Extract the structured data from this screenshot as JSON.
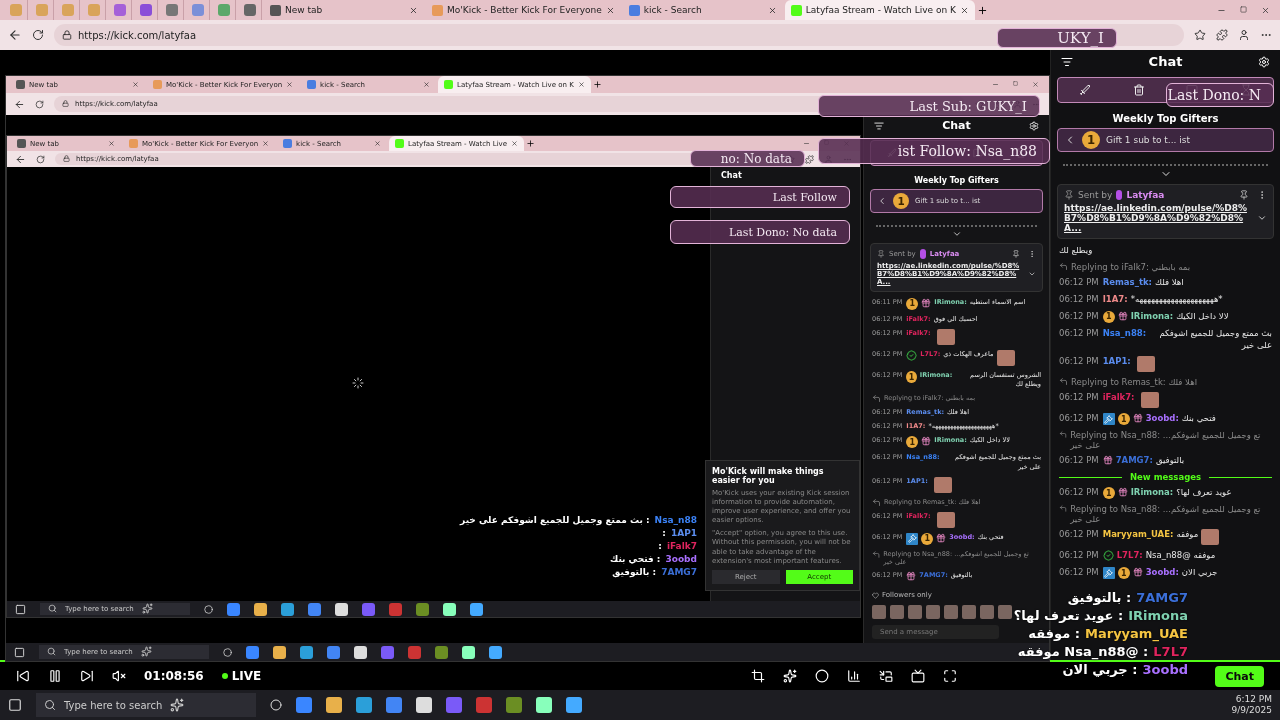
{
  "tabs": [
    {
      "label": "New tab",
      "selected": false
    },
    {
      "label": "Mo'Kick - Better Kick For Everyone",
      "selected": false
    },
    {
      "label": "kick - Search",
      "selected": false
    },
    {
      "label": "Latyfaa Stream - Watch Live on K",
      "selected": true
    }
  ],
  "address": {
    "url": "https://kick.com/latyfaa"
  },
  "chat": {
    "title": "Chat",
    "gifters_title": "Weekly Top Gifters",
    "gifter": {
      "rank": "1",
      "text": "Gift 1 sub to t... ist"
    },
    "pinned": {
      "sent_by": "Sent by",
      "user": "Latyfaa",
      "link": "https://ae.linkedin.com/pulse/%D8%B7%D8%B1%D9%8A%D9%82%D8%A..."
    },
    "messages": [
      {
        "kind": "text",
        "text": "ويطلع لك"
      },
      {
        "kind": "reply",
        "text": "Replying to iFalk7: بمه بابطني"
      },
      {
        "kind": "message",
        "time": "06:12 PM",
        "user": "Remas_tk:",
        "color": "#5b8def",
        "text": "اهلا فلك"
      },
      {
        "kind": "message",
        "time": "06:12 PM",
        "user": "I1A7:",
        "color": "#f08a8a",
        "text": "*ههههههههههههههههههههه*"
      },
      {
        "kind": "message",
        "time": "06:12 PM",
        "badges": [
          {
            "kind": "sub",
            "text": "1"
          },
          {
            "kind": "gift"
          }
        ],
        "user": "IRimona:",
        "color": "#7fd1b0",
        "text": "لالا داخل الكيك"
      },
      {
        "kind": "message",
        "time": "06:12 PM",
        "user": "Nsa_n88:",
        "color": "#3b82f6",
        "text": "بث ممتع وجميل للجميع اشوفكم على خير"
      },
      {
        "kind": "message",
        "time": "06:12 PM",
        "user": "1AP1:",
        "color": "#5b8def",
        "emote": true
      },
      {
        "kind": "reply",
        "text": "Replying to Remas_tk: اهلا فلك"
      },
      {
        "kind": "message",
        "time": "06:12 PM",
        "user": "iFalk7:",
        "color": "#e0245e",
        "emote": true
      },
      {
        "kind": "message",
        "time": "06:12 PM",
        "badges": [
          {
            "kind": "mod"
          },
          {
            "kind": "sub",
            "text": "1"
          },
          {
            "kind": "gift"
          }
        ],
        "user": "3oobd:",
        "color": "#a970ff",
        "text": "فتحي بنك"
      },
      {
        "kind": "reply",
        "text": "Replying to Nsa_n88: ...تع وجميل للجميع اشوفكم على خير"
      },
      {
        "kind": "message",
        "time": "06:12 PM",
        "badges": [
          {
            "kind": "gift"
          }
        ],
        "user": "7AMG7:",
        "color": "#3b6fd8",
        "text": "بالتوفيق"
      },
      {
        "kind": "divider",
        "text": "New messages"
      },
      {
        "kind": "message",
        "time": "06:12 PM",
        "badges": [
          {
            "kind": "sub",
            "text": "1"
          },
          {
            "kind": "gift"
          }
        ],
        "user": "IRimona:",
        "color": "#7fd1b0",
        "text": "عويد تعرف لها؟"
      },
      {
        "kind": "reply",
        "text": "Replying to Nsa_n88: ...تع وجميل للجميع اشوفكم على خير"
      },
      {
        "kind": "message",
        "time": "06:12 PM",
        "user": "Maryyam_UAE:",
        "color": "#f5c542",
        "text": "موفقه",
        "emote": true
      },
      {
        "kind": "message",
        "time": "06:12 PM",
        "badges": [
          {
            "kind": "verified"
          }
        ],
        "user": "L7L7:",
        "color": "#e0245e",
        "text": "موفقه @Nsa_n88"
      },
      {
        "kind": "message",
        "time": "06:12 PM",
        "badges": [
          {
            "kind": "mod"
          },
          {
            "kind": "sub",
            "text": "1"
          },
          {
            "kind": "gift"
          }
        ],
        "user": "3oobd:",
        "color": "#a970ff",
        "text": "جربي الان"
      }
    ]
  },
  "player": {
    "time": "01:08:56",
    "live": "LIVE",
    "chat_button": "Chat"
  },
  "banners": [
    "UKY_I",
    "Last Sub: GUKY_I",
    "no: No data",
    "ist Follow: Nsa_n88",
    "Last Dono: N",
    "Last Follow",
    "Last Dono: No data"
  ],
  "stream_overlay": [
    {
      "user": "7AMG7",
      "color": "#3b6fd8",
      "text": ": بالتوفيق"
    },
    {
      "user": "IRimona",
      "color": "#7fd1b0",
      "text": ": عويد تعرف لها؟"
    },
    {
      "user": "Maryyam_UAE",
      "color": "#f5c542",
      "text": ": موفقه"
    },
    {
      "user": "L7L7",
      "color": "#e0245e",
      "text": ": @Nsa_n88 موفقه"
    },
    {
      "user": "3oobd",
      "color": "#a970ff",
      "text": ": جربي الان"
    }
  ],
  "stream_overlay_nested": [
    {
      "user": "Nsa_n88",
      "color": "#3b82f6",
      "text": ": بث ممتع وجميل للجميع اشوفكم على خير"
    },
    {
      "user": "1AP1",
      "color": "#5b8def",
      "text": ":"
    },
    {
      "user": "iFalk7",
      "color": "#e0245e",
      "text": ":"
    },
    {
      "user": "3oobd",
      "color": "#a970ff",
      "text": ": فتحي بنك"
    },
    {
      "user": "7AMG7",
      "color": "#3b6fd8",
      "text": ": بالتوفيق"
    }
  ],
  "nested": {
    "tabs": [
      {
        "label": "New tab",
        "selected": false
      },
      {
        "label": "Mo'Kick - Better Kick For Everyon",
        "selected": false
      },
      {
        "label": "kick - Search",
        "selected": false
      },
      {
        "label": "Latyfaa Stream - Watch Live on K",
        "selected": true
      }
    ],
    "url": "https://kick.com/latyfaa",
    "search_placeholder": "Type here to search",
    "chat": {
      "title": "Chat",
      "gifters_title": "Weekly Top Gifters",
      "gifter": {
        "rank": "1",
        "text": "Gift 1 sub to t... ist"
      },
      "pinned": {
        "sent_by": "Sent by",
        "user": "Latyfaa",
        "link": "https://ae.linkedin.com/pulse/%D8%B7%D8%B1%D9%8A%D9%82%D8%A..."
      },
      "messages": [
        {
          "kind": "message",
          "time": "06:11 PM",
          "badges": [
            {
              "kind": "sub",
              "text": "1"
            },
            {
              "kind": "gift"
            }
          ],
          "user": "IRimona:",
          "color": "#7fd1b0",
          "text": "اسم الاسماء استطيه"
        },
        {
          "kind": "message",
          "time": "06:12 PM",
          "user": "iFalk7:",
          "color": "#e0245e",
          "text": "احسبك الي فوق"
        },
        {
          "kind": "message",
          "time": "06:12 PM",
          "user": "iFalk7:",
          "color": "#e0245e",
          "emote": true
        },
        {
          "kind": "message",
          "time": "06:12 PM",
          "badges": [
            {
              "kind": "verified"
            }
          ],
          "user": "L7L7:",
          "color": "#e0245e",
          "text": "ماعرف الهكات ذي",
          "emote": true
        },
        {
          "kind": "message",
          "time": "06:12 PM",
          "badges": [
            {
              "kind": "sub",
              "text": "1"
            }
          ],
          "user": "IRimona:",
          "color": "#7fd1b0",
          "text": "الشروس تستفسان الرسم ويطلع لك"
        },
        {
          "kind": "reply",
          "text": "Replying to iFalk7: بمه بابطني"
        },
        {
          "kind": "message",
          "time": "06:12 PM",
          "user": "Remas_tk:",
          "color": "#5b8def",
          "text": "اهلا فلك"
        },
        {
          "kind": "message",
          "time": "06:12 PM",
          "user": "I1A7:",
          "color": "#f08a8a",
          "text": "*ههههههههههههههههههههه*"
        },
        {
          "kind": "message",
          "time": "06:12 PM",
          "badges": [
            {
              "kind": "sub",
              "text": "1"
            },
            {
              "kind": "gift"
            }
          ],
          "user": "IRimona:",
          "color": "#7fd1b0",
          "text": "لالا داخل الكيك"
        },
        {
          "kind": "message",
          "time": "06:12 PM",
          "user": "Nsa_n88:",
          "color": "#3b82f6",
          "text": "بث ممتع وجميل للجميع اشوفكم على خير"
        },
        {
          "kind": "message",
          "time": "06:12 PM",
          "user": "1AP1:",
          "color": "#5b8def",
          "emote": true
        },
        {
          "kind": "reply",
          "text": "Replying to Remas_tk: اهلا فلك"
        },
        {
          "kind": "message",
          "time": "06:12 PM",
          "user": "iFalk7:",
          "color": "#e0245e",
          "emote": true
        },
        {
          "kind": "message",
          "time": "06:12 PM",
          "badges": [
            {
              "kind": "mod"
            },
            {
              "kind": "sub",
              "text": "1"
            },
            {
              "kind": "gift"
            }
          ],
          "user": "3oobd:",
          "color": "#a970ff",
          "text": "فتحي بنك"
        },
        {
          "kind": "reply",
          "text": "Replying to Nsa_n88: ...تع وجميل للجميع اشوفكم على خير"
        },
        {
          "kind": "message",
          "time": "06:12 PM",
          "badges": [
            {
              "kind": "gift"
            }
          ],
          "user": "7AMG7:",
          "color": "#3b6fd8",
          "text": "بالتوفيق"
        }
      ],
      "followers_only": "Followers only",
      "send_placeholder": "Send a message"
    },
    "inner": {
      "tabs": [
        {
          "label": "New tab",
          "selected": false
        },
        {
          "label": "Mo'Kick - Better Kick For Everyon",
          "selected": false
        },
        {
          "label": "kick - Search",
          "selected": false
        },
        {
          "label": "Latyfaa Stream - Watch Live",
          "selected": true
        }
      ],
      "url": "https://kick.com/latyfaa",
      "chat_title": "Chat",
      "search_placeholder": "Type here to search"
    }
  },
  "popup": {
    "title": "Mo'Kick will make things easier for you",
    "body": "Mo'Kick uses your existing Kick session information to provide automation, improve user experience, and offer you easier options.",
    "body_2": "\"Accept\" option, you agree to this use. Without this permission, you will not be able to take advantage of the extension's most important features.",
    "reject": "Reject",
    "accept": "Accept"
  },
  "taskbar": {
    "search_placeholder": "Type here to search",
    "time": "6:12 PM",
    "date": "9/9/2025"
  }
}
